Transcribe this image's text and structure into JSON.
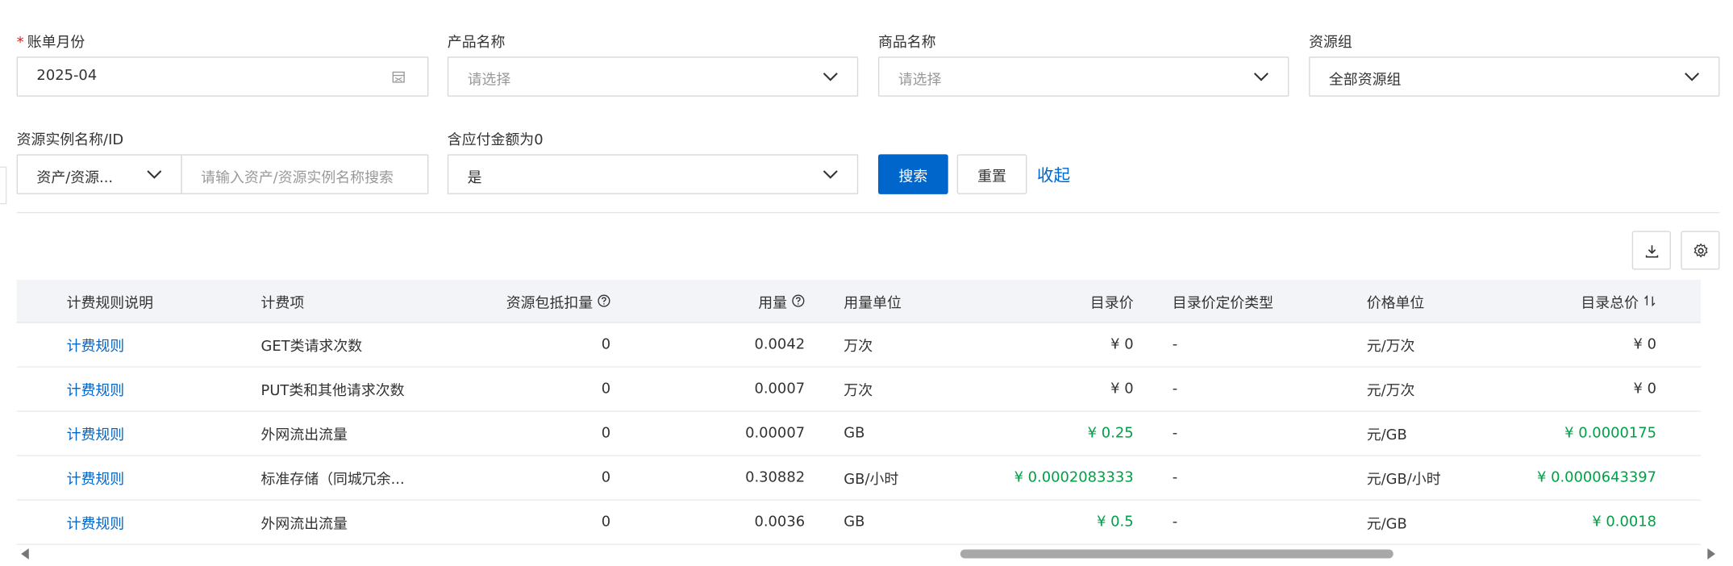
{
  "filters": {
    "bill_month": {
      "label": "账单月份",
      "required_mark": "*",
      "value": "2025-04"
    },
    "product_name": {
      "label": "产品名称",
      "placeholder": "请选择"
    },
    "goods_name": {
      "label": "商品名称",
      "placeholder": "请选择"
    },
    "resource_group": {
      "label": "资源组",
      "value": "全部资源组"
    },
    "resource_instance": {
      "label": "资源实例名称/ID",
      "type_value": "资产/资源...",
      "placeholder": "请输入资产/资源实例名称搜索"
    },
    "zero_amount": {
      "label": "含应付金额为0",
      "value": "是"
    }
  },
  "actions": {
    "search": "搜索",
    "reset": "重置",
    "collapse": "收起"
  },
  "toolbar": {
    "download_icon": "download-icon",
    "settings_icon": "gear-icon"
  },
  "table": {
    "columns": [
      "计费规则说明",
      "计费项",
      "资源包抵扣量",
      "用量",
      "用量单位",
      "目录价",
      "目录价定价类型",
      "价格单位",
      "目录总价"
    ],
    "rows": [
      {
        "rule": "计费规则",
        "item": "GET类请求次数",
        "deduct": "0",
        "usage": "0.0042",
        "unit": "万次",
        "price": "¥ 0",
        "price_type": "-",
        "price_unit": "元/万次",
        "total": "¥ 0"
      },
      {
        "rule": "计费规则",
        "item": "PUT类和其他请求次数",
        "deduct": "0",
        "usage": "0.0007",
        "unit": "万次",
        "price": "¥ 0",
        "price_type": "-",
        "price_unit": "元/万次",
        "total": "¥ 0"
      },
      {
        "rule": "计费规则",
        "item": "外网流出流量",
        "deduct": "0",
        "usage": "0.00007",
        "unit": "GB",
        "price": "¥ 0.25",
        "price_type": "-",
        "price_unit": "元/GB",
        "total": "¥ 0.0000175"
      },
      {
        "rule": "计费规则",
        "item": "标准存储（同城冗余...",
        "deduct": "0",
        "usage": "0.30882",
        "unit": "GB/小时",
        "price": "¥ 0.0002083333",
        "price_type": "-",
        "price_unit": "元/GB/小时",
        "total": "¥ 0.0000643397"
      },
      {
        "rule": "计费规则",
        "item": "外网流出流量",
        "deduct": "0",
        "usage": "0.0036",
        "unit": "GB",
        "price": "¥ 0.5",
        "price_type": "-",
        "price_unit": "元/GB",
        "total": "¥ 0.0018"
      }
    ]
  },
  "colors": {
    "primary": "#0066cc",
    "green": "#00a047",
    "header_bg": "#f2f4f7",
    "required": "#e02020"
  }
}
